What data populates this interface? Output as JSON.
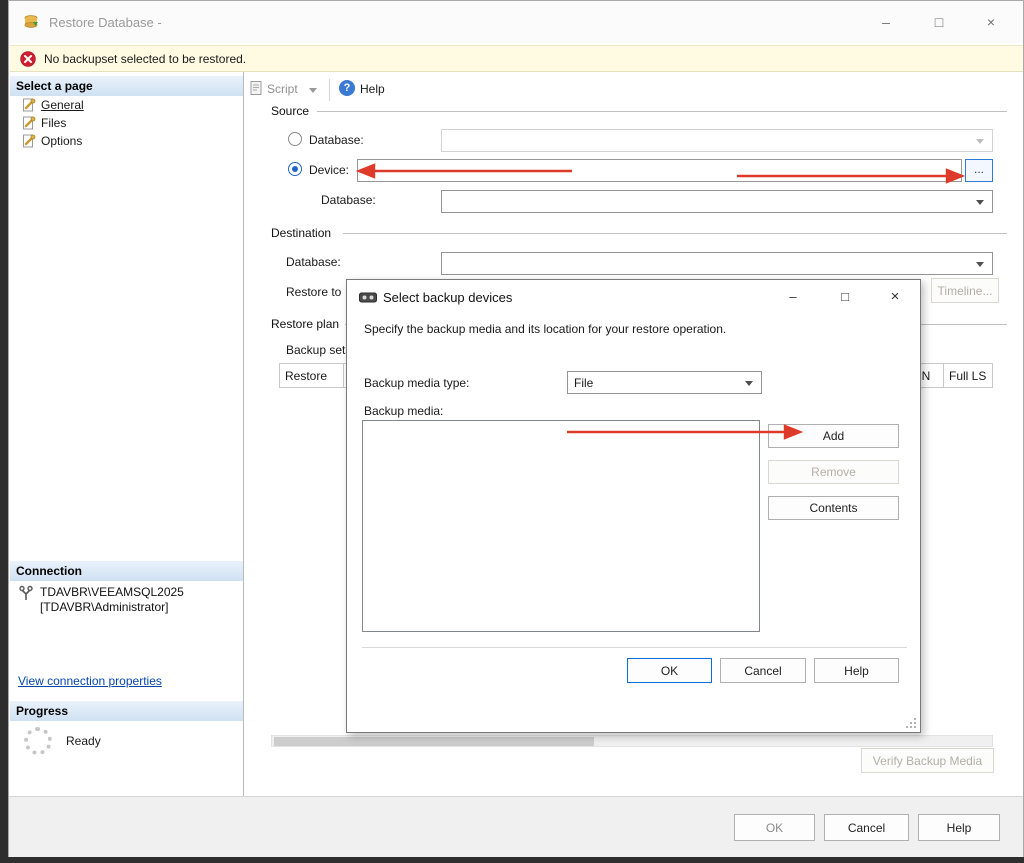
{
  "window": {
    "title": "Restore Database -",
    "controls": {
      "minimize": "–",
      "maximize": "□",
      "close": "×"
    }
  },
  "warning_bar": {
    "message": "No backupset selected to be restored."
  },
  "toolbar": {
    "script": "Script",
    "help": "Help"
  },
  "sidebar": {
    "header": "Select a page",
    "items": [
      {
        "label": "General"
      },
      {
        "label": "Files"
      },
      {
        "label": "Options"
      }
    ],
    "connection": {
      "header": "Connection",
      "server_line1": "TDAVBR\\VEEAMSQL2025",
      "server_line2": "[TDAVBR\\Administrator]",
      "link": "View connection properties"
    },
    "progress": {
      "header": "Progress",
      "status": "Ready"
    }
  },
  "source": {
    "group_label": "Source",
    "database_radio_label": "Database:",
    "device_radio_label": "Device:",
    "device_database_label": "Database:"
  },
  "destination": {
    "group_label": "Destination",
    "database_label": "Database:",
    "restore_to_label": "Restore to",
    "timeline_button": "Timeline..."
  },
  "restore_plan": {
    "group_label": "Restore plan",
    "backup_sets_label": "Backup sets",
    "columns": [
      "Restore",
      "N",
      "LSN",
      "Full LS"
    ]
  },
  "device_dialog": {
    "title": "Select backup devices",
    "description": "Specify the backup media and its location for your restore operation.",
    "media_type_label": "Backup media type:",
    "media_type_value": "File",
    "media_list_label": "Backup media:",
    "buttons": {
      "add": "Add",
      "remove": "Remove",
      "contents": "Contents",
      "ok": "OK",
      "cancel": "Cancel",
      "help": "Help"
    },
    "controls": {
      "minimize": "–",
      "maximize": "□",
      "close": "×"
    }
  },
  "footer": {
    "verify_button": "Verify Backup Media",
    "ok": "OK",
    "cancel": "Cancel",
    "help": "Help"
  },
  "misc": {
    "browse": "...",
    "help_glyph": "?"
  },
  "colors": {
    "accent": "#2e7bd6",
    "arrow_red": "#dd3a2a",
    "warning_bg": "#fffbe3",
    "header_gradient_top": "#eaf2fb",
    "header_gradient_bottom": "#cfe1f2"
  }
}
